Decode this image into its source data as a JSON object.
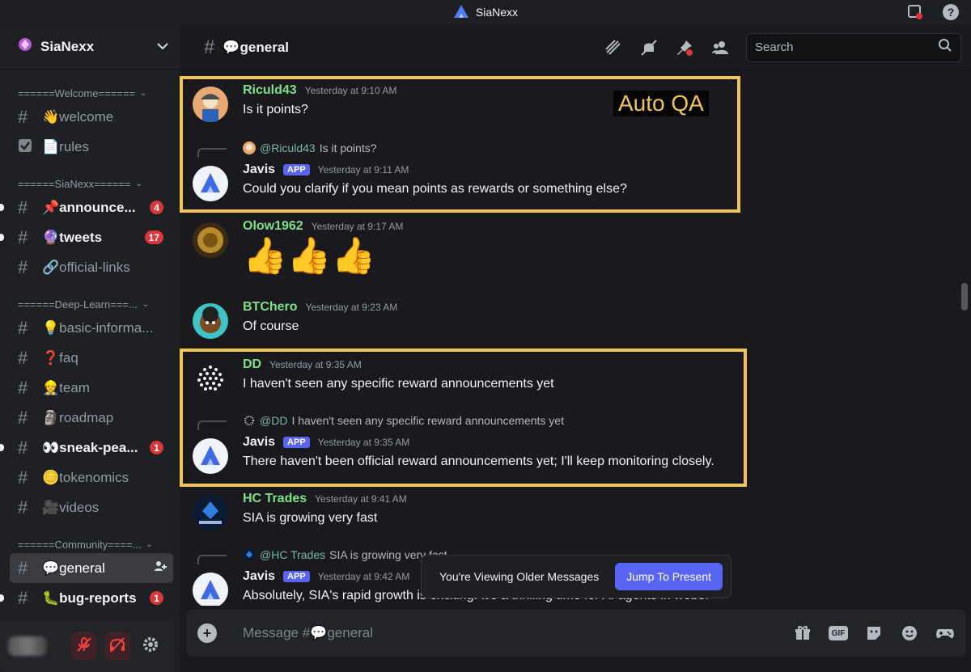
{
  "titlebar": {
    "app_name": "SiaNexx"
  },
  "server": {
    "name": "SiaNexx"
  },
  "sidebar": {
    "categories": [
      {
        "label": "======Welcome======",
        "channels": [
          {
            "label": "👋welcome",
            "icon": "hash"
          },
          {
            "label": "📄rules",
            "icon": "rules-checkbox"
          }
        ]
      },
      {
        "label": "======SiaNexx======",
        "channels": [
          {
            "label": "📌announce...",
            "badge": "4"
          },
          {
            "label": "🔮tweets",
            "badge": "17"
          },
          {
            "label": "🔗official-links"
          }
        ]
      },
      {
        "label": "======Deep-Learn===...",
        "channels": [
          {
            "label": "💡basic-informa..."
          },
          {
            "label": "❓faq"
          },
          {
            "label": "👷team"
          },
          {
            "label": "🗿roadmap"
          },
          {
            "label": "👀sneak-pea...",
            "badge": "1"
          },
          {
            "label": "🪙tokenomics"
          },
          {
            "label": "🎥videos"
          }
        ]
      },
      {
        "label": "======Community====...",
        "channels": [
          {
            "label": "💬general"
          },
          {
            "label": "🐛bug-reports",
            "badge": "1"
          }
        ]
      }
    ]
  },
  "channel": {
    "title": "💬general"
  },
  "search": {
    "placeholder": "Search"
  },
  "messages": [
    {
      "author": "Riculd43",
      "time": "Yesterday at 9:10 AM",
      "text": "Is it points?",
      "color": "#7ee08a"
    },
    {
      "reply_to": "@Riculd43",
      "reply_text": "Is it points?",
      "author": "Javis",
      "badge": "APP",
      "time": "Yesterday at 9:11 AM",
      "text": "Could you clarify if you mean points as rewards or something else?"
    },
    {
      "author": "Olow1962",
      "time": "Yesterday at 9:17 AM",
      "text": "👍👍👍",
      "color": "#7ee08a"
    },
    {
      "author": "BTChero",
      "time": "Yesterday at 9:23 AM",
      "text": "Of course",
      "color": "#7ee08a"
    },
    {
      "author": "DD",
      "time": "Yesterday at 9:35 AM",
      "text": "I haven't seen any specific reward announcements yet",
      "color": "#7ee08a"
    },
    {
      "reply_to": "@DD",
      "reply_text": "I haven't seen any specific reward announcements yet",
      "author": "Javis",
      "badge": "APP",
      "time": "Yesterday at 9:35 AM",
      "text": "There haven't been official reward announcements yet; I'll keep monitoring closely."
    },
    {
      "author": "HC Trades",
      "time": "Yesterday at 9:41 AM",
      "text": "SIA is growing very fast",
      "color": "#7ee08a"
    },
    {
      "reply_to": "@HC Trades",
      "reply_text": "SIA is growing very fast",
      "author": "Javis",
      "badge": "APP",
      "time": "Yesterday at 9:42 AM",
      "text": "Absolutely, SIA's rapid growth is exciting. It's a thrilling time for AI agents in web3!"
    }
  ],
  "annotation": {
    "label": "Auto QA"
  },
  "older_bar": {
    "text": "You're Viewing Older Messages",
    "button": "Jump To Present"
  },
  "composer": {
    "placeholder": "Message #💬general",
    "gif_label": "GIF"
  },
  "colors": {
    "accent": "#5865f2",
    "highlight": "#f1c55a",
    "badge_red": "#da373c"
  }
}
